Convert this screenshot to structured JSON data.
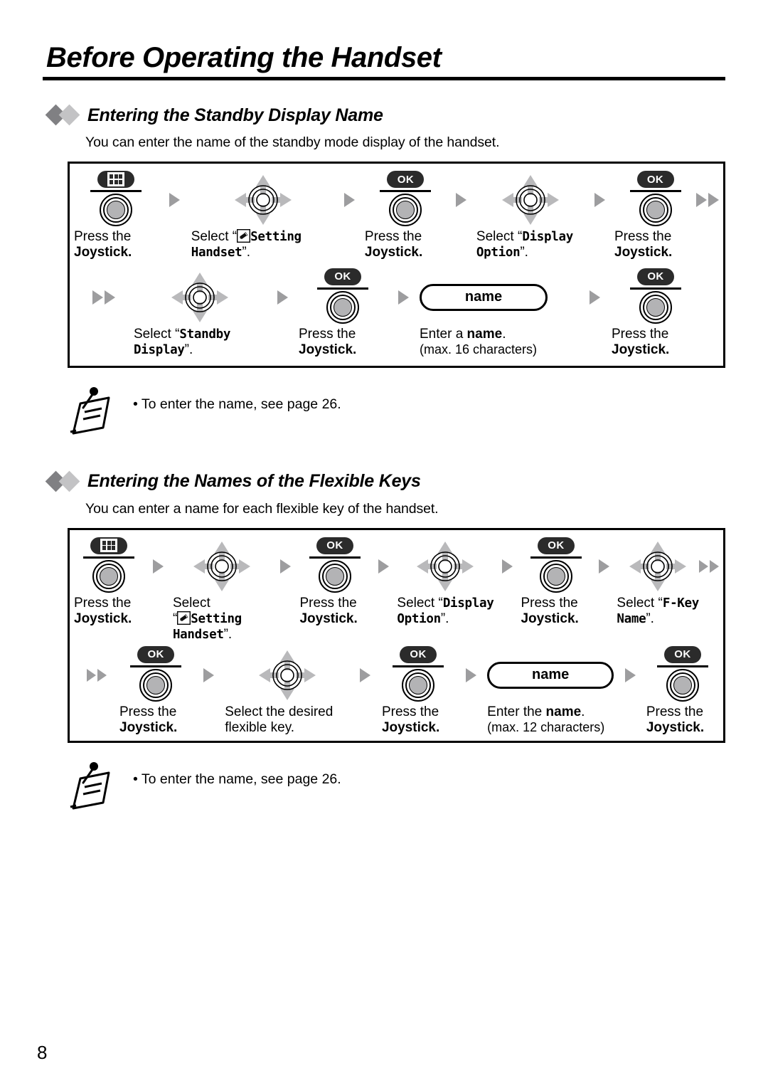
{
  "page": {
    "title": "Before Operating the Handset",
    "number": "8"
  },
  "sections": [
    {
      "heading": "Entering the Standby Display Name",
      "description": "You can enter the name of the standby mode display of the handset.",
      "note": "• To enter the name, see page 26.",
      "note_icon": "note-pencil-icon",
      "flow": {
        "row1": [
          {
            "icon": "joystick-menu-key-icon",
            "cap": "menu-grid-icon",
            "line1": "Press the",
            "line1_bold": false,
            "line2": "Joystick.",
            "line2_bold": true
          },
          {
            "icon": "navigator-4way-icon",
            "line1": "Select “",
            "pencil": true,
            "line1_mono": "Setting",
            "line2_mono": "Handset",
            "line2_tail": "”."
          },
          {
            "icon": "joystick-ok-key-icon",
            "cap": "OK",
            "line1": "Press the",
            "line2": "Joystick.",
            "line2_bold": true
          },
          {
            "icon": "navigator-4way-icon",
            "line1": "Select “",
            "line1_mono": "Display",
            "line2_mono": "Option",
            "line2_tail": "”."
          },
          {
            "icon": "joystick-ok-key-icon",
            "cap": "OK",
            "line1": "Press the",
            "line2": "Joystick.",
            "line2_bold": true
          }
        ],
        "row2": [
          {
            "icon": "navigator-4way-icon",
            "line1": "Select “",
            "line1_mono": "Standby",
            "line2_mono": "Display",
            "line2_tail": "”."
          },
          {
            "icon": "joystick-ok-key-icon",
            "cap": "OK",
            "line1": "Press the",
            "line2": "Joystick.",
            "line2_bold": true
          },
          {
            "icon": "name-input-pill",
            "pill": "name",
            "line1": "Enter a ",
            "line1_bold": "name",
            "line1_tail": ".",
            "line2": "(max. 16 characters)"
          },
          {
            "icon": "joystick-ok-key-icon",
            "cap": "OK",
            "line1": "Press the",
            "line2": "Joystick.",
            "line2_bold": true
          }
        ]
      },
      "labels": {
        "press_the": "Press the",
        "joystick": "Joystick.",
        "select_open": "Select “",
        "quote_close": "”.",
        "setting": "Setting",
        "handset": "Handset",
        "display": "Display",
        "option": "Option",
        "standby": "Standby",
        "display2": "Display",
        "enter_a": "Enter a ",
        "name_bold": "name",
        "period": ".",
        "max_chars": "(max. 16 characters)",
        "name_pill": "name",
        "ok": "OK",
        "select": "Select"
      }
    },
    {
      "heading": "Entering the Names of the Flexible Keys",
      "description": "You can enter a name for each flexible key of the handset.",
      "note": "• To enter the name, see page 26.",
      "note_icon": "note-pencil-icon",
      "labels": {
        "press_the": "Press the",
        "joystick": "Joystick.",
        "select": "Select",
        "select_open": "Select “",
        "quote_open": "“",
        "quote_close": "”.",
        "setting": "Setting",
        "handset": "Handset",
        "display": "Display",
        "option": "Option",
        "fkey": "F-Key",
        "name_mono": "Name",
        "select_desired": "Select the desired",
        "flexible_key": "flexible key.",
        "enter_the": "Enter the ",
        "name_bold": "name",
        "period": ".",
        "max_chars": "(max. 12 characters)",
        "name_pill": "name",
        "ok": "OK"
      }
    }
  ],
  "colors": {
    "arrow_gray": "#9d9d9f",
    "diamond_dark": "#808083",
    "diamond_light": "#c3c3c5",
    "cap_dark": "#2b2b2b",
    "knob_fill": "#b3b3b5",
    "nav_arrow": "#b9b9bb"
  }
}
